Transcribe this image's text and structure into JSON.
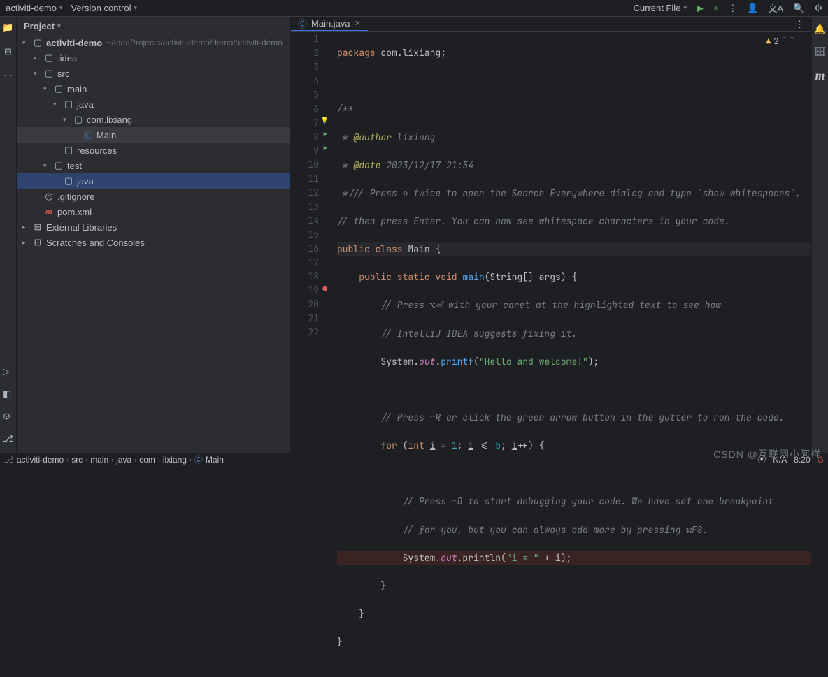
{
  "topbar": {
    "project": "activiti-demo",
    "vcs": "Version control",
    "currentFile": "Current File"
  },
  "projectPanel": {
    "title": "Project"
  },
  "tree": {
    "root": "activiti-demo",
    "rootPath": "~/IdeaProjects/activiti-demo/demo/activiti-demo",
    "idea": ".idea",
    "src": "src",
    "main": "main",
    "java": "java",
    "pkg": "com.lixiang",
    "mainClass": "Main",
    "resources": "resources",
    "test": "test",
    "java2": "java",
    "gitignore": ".gitignore",
    "pom": "pom.xml",
    "extLib": "External Libraries",
    "scratches": "Scratches and Consoles"
  },
  "tab": {
    "filename": "Main.java"
  },
  "code": {
    "l1": "package com.lixiang;",
    "l2": "",
    "l3": "/**",
    "l4": " * @author lixiang",
    "l5": " * @date 2023/12/17 21:54",
    "l6": " *//// Press ⇧ twice to open the Search Everywhere dialog and type `show whitespaces`,",
    "l7": "// then press Enter. You can now see whitespace characters in your code.",
    "l8": "public class Main {",
    "l9": "    public static void main(String[] args) {",
    "l10": "        // Press ⌥⏎ with your caret at the highlighted text to see how",
    "l11": "        // IntelliJ IDEA suggests fixing it.",
    "l12": "        System.out.printf(\"Hello and welcome!\");",
    "l13": "",
    "l14": "        // Press ⌃R or click the green arrow button in the gutter to run the code.",
    "l15": "        for (int i = 1; i <= 5; i++) {",
    "l16": "",
    "l17": "            // Press ⌃D to start debugging your code. We have set one breakpoint",
    "l18": "            // for you, but you can always add more by pressing ⌘F8.",
    "l19": "            System.out.println(\"i = \" + i);",
    "l20": "        }",
    "l21": "    }",
    "l22": "}"
  },
  "warnings": {
    "count": "2"
  },
  "breadcrumb": {
    "b1": "activiti-demo",
    "b2": "src",
    "b3": "main",
    "b4": "java",
    "b5": "com",
    "b6": "lixiang",
    "b7": "Main"
  },
  "status": {
    "coverage": "N/A",
    "pos": "8:20"
  },
  "watermark": "CSDN @互联网小阿祥"
}
